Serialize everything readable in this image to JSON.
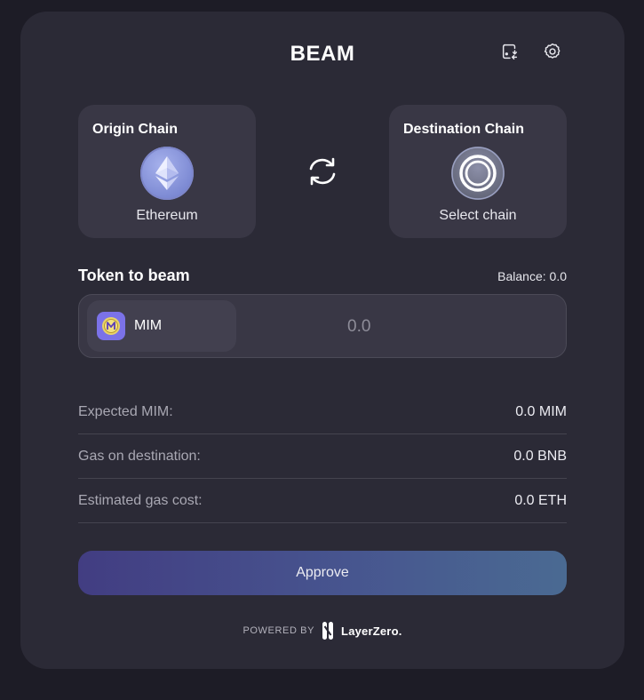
{
  "header": {
    "title": "BEAM",
    "wallet_icon": "wallet-swap-icon",
    "settings_icon": "gear-icon"
  },
  "origin": {
    "label": "Origin Chain",
    "chain_name": "Ethereum",
    "icon": "ethereum-logo-icon"
  },
  "destination": {
    "label": "Destination Chain",
    "chain_name": "Select chain",
    "icon": "ring-placeholder-icon"
  },
  "swap_icon": "swap-arrows-icon",
  "token": {
    "label": "Token to beam",
    "balance": "Balance: 0.0",
    "symbol": "MIM",
    "amount_placeholder": "0.0"
  },
  "info": [
    {
      "key": "Expected MIM:",
      "value": "0.0 MIM"
    },
    {
      "key": "Gas on destination:",
      "value": "0.0 BNB"
    },
    {
      "key": "Estimated gas cost:",
      "value": "0.0 ETH"
    }
  ],
  "approve_label": "Approve",
  "footer": {
    "powered_by": "POWERED BY",
    "brand": "LayerZero."
  },
  "colors": {
    "background": "#1d1c26",
    "card": "#2b2a36",
    "panel": "#393745",
    "accent_start": "#423d82",
    "accent_end": "#4a6a92"
  }
}
